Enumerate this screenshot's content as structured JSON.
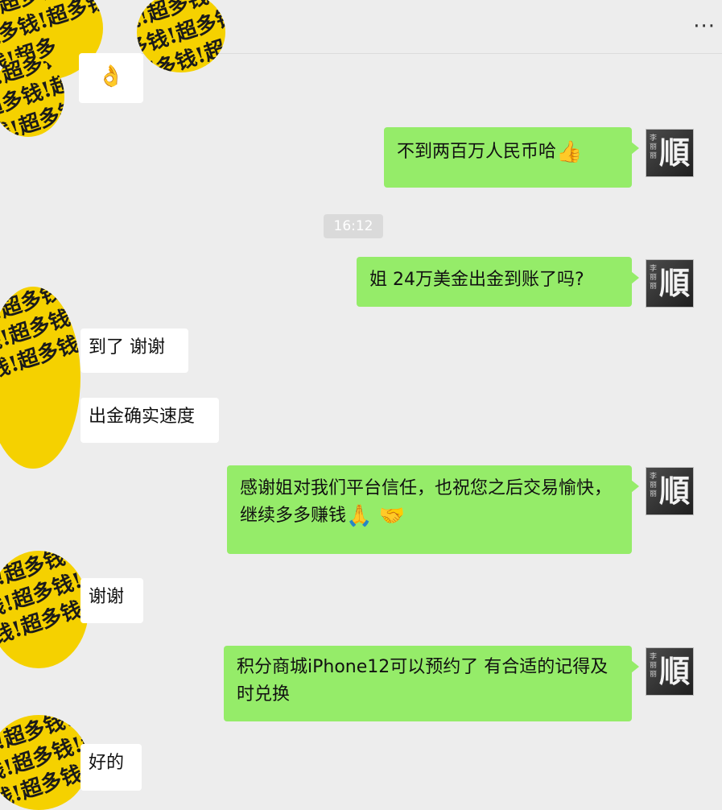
{
  "header": {
    "more_icon": "more-horizontal-icon",
    "more_label": "···"
  },
  "contact_avatar": {
    "pattern": "钱!超多钱!超多钱!超多钱!超多钱!超多钱!超多"
  },
  "my_avatar": {
    "seal": "李丽丽",
    "glyph": "順"
  },
  "timestamp": "16:12",
  "messages": [
    {
      "id": "m0",
      "side": "left",
      "text": "👌"
    },
    {
      "id": "m1",
      "side": "right",
      "text": "不到两百万人民币哈",
      "emoji": "👍"
    },
    {
      "id": "m2",
      "side": "right",
      "text": "姐 24万美金出金到账了吗?"
    },
    {
      "id": "m3",
      "side": "left",
      "text": "到了 谢谢"
    },
    {
      "id": "m4",
      "side": "left",
      "text": "出金确实速度"
    },
    {
      "id": "m5",
      "side": "right",
      "text": "感谢姐对我们平台信任，也祝您之后交易愉快，继续多多赚钱",
      "emoji": "🙏 🤝"
    },
    {
      "id": "m6",
      "side": "left",
      "text": "谢谢"
    },
    {
      "id": "m7",
      "side": "right",
      "text": "积分商城iPhone12可以预约了  有合适的记得及时兑换"
    },
    {
      "id": "m8",
      "side": "left",
      "text": "好的"
    }
  ]
}
